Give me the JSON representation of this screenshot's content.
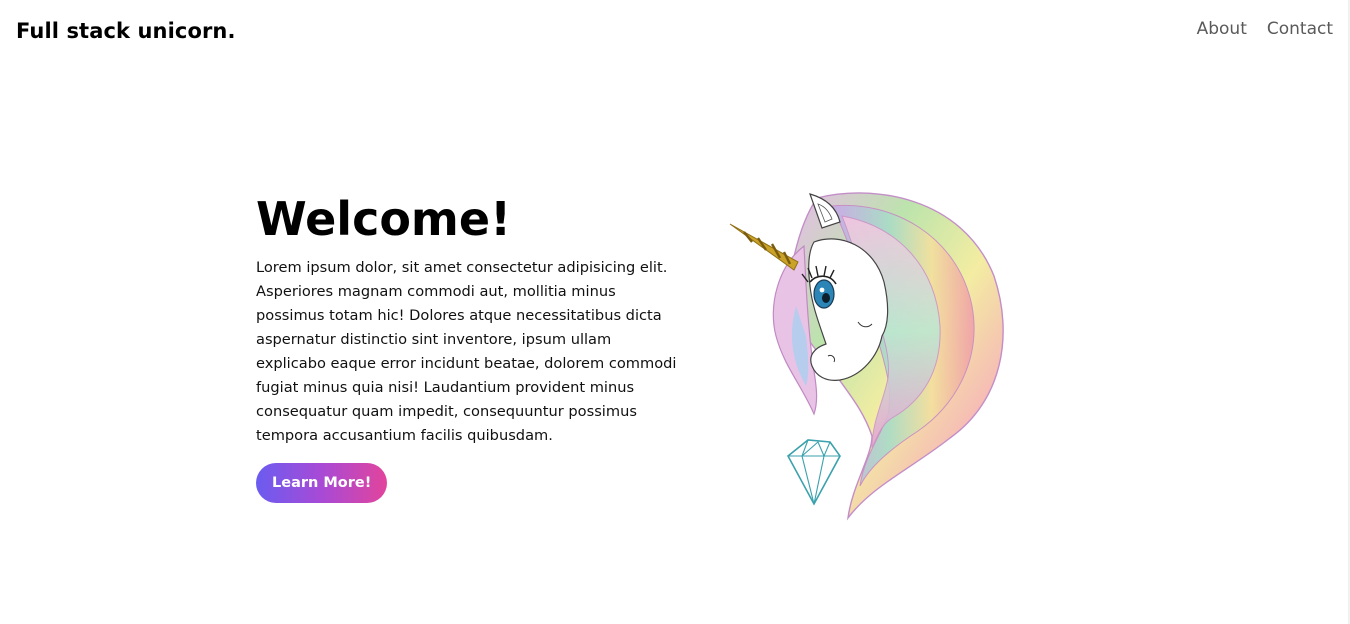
{
  "header": {
    "brand": "Full stack unicorn.",
    "nav": [
      {
        "label": "About"
      },
      {
        "label": "Contact"
      }
    ]
  },
  "hero": {
    "title": "Welcome!",
    "body": "Lorem ipsum dolor, sit amet consectetur adipisicing elit. Asperiores magnam commodi aut, mollitia minus possimus totam hic! Dolores atque necessitatibus dicta aspernatur distinctio sint inventore, ipsum ullam explicabo eaque error incidunt beatae, dolorem commodi fugiat minus quia nisi! Laudantium provident minus consequatur quam impedit, consequuntur possimus tempora accusantium facilis quibusdam.",
    "button_label": "Learn More!"
  },
  "illustration": {
    "icon": "unicorn-illustration",
    "accent_colors": {
      "horn": "#c9a227",
      "eye": "#2b86b7",
      "gem": "#3aa1ad"
    }
  },
  "colors": {
    "button_gradient_start": "#6a5cf0",
    "button_gradient_end": "#e2449c",
    "nav_text": "#5a5a5a"
  }
}
